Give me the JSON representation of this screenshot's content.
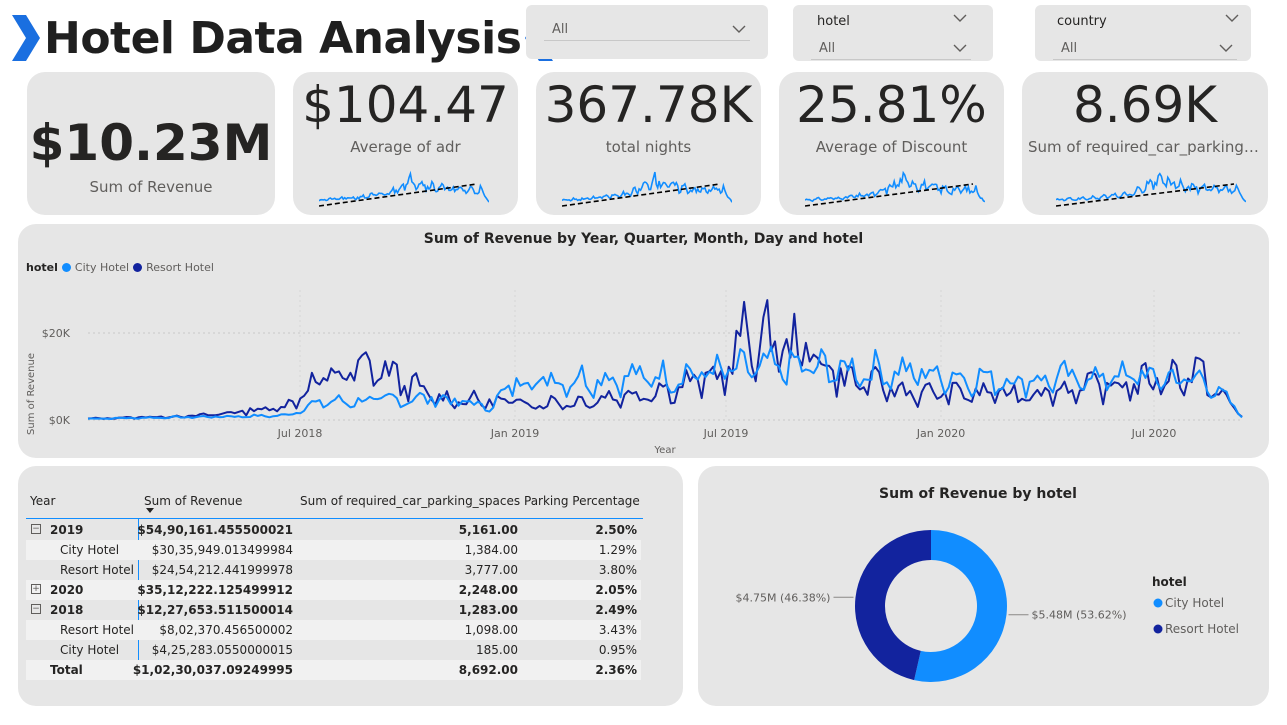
{
  "header": {
    "title": "Hotel Data Analysis"
  },
  "slicers": {
    "first": {
      "value": "All"
    },
    "hotel": {
      "title": "hotel",
      "value": "All"
    },
    "country": {
      "title": "country",
      "value": "All"
    }
  },
  "kpis": [
    {
      "value": "$10.23M",
      "label": "Sum of Revenue"
    },
    {
      "value": "$104.47",
      "label": "Average of adr"
    },
    {
      "value": "367.78K",
      "label": "total nights"
    },
    {
      "value": "25.81%",
      "label": "Average of Discount"
    },
    {
      "value": "8.69K",
      "label": "Sum of required_car_parking_spaces"
    }
  ],
  "colors": {
    "city_hotel": "#118DFF",
    "resort_hotel": "#12239E",
    "card_bg": "#e6e6e6",
    "chevron": "#1a6fe0"
  },
  "line_chart": {
    "title": "Sum of Revenue by Year, Quarter, Month, Day and hotel",
    "legend_title": "hotel",
    "legend_items": [
      "City Hotel",
      "Resort Hotel"
    ],
    "y_axis_label": "Sum of Revenue",
    "x_axis_label": "Year",
    "y_ticks": [
      "$20K",
      "$0K"
    ],
    "x_ticks": [
      "Jul 2018",
      "Jan 2019",
      "Jul 2019",
      "Jan 2020",
      "Jul 2020"
    ]
  },
  "table": {
    "headers": [
      "Year",
      "Sum of Revenue",
      "Sum of required_car_parking_spaces",
      "Parking Percentage"
    ],
    "rows": [
      {
        "kind": "year",
        "expander": "⊟",
        "label": "2019",
        "revenue": "$54,90,161.455500021",
        "parking": "5,161.00",
        "pct": "2.50%"
      },
      {
        "kind": "child",
        "label": "City Hotel",
        "revenue": "$30,35,949.013499984",
        "parking": "1,384.00",
        "pct": "1.29%"
      },
      {
        "kind": "child",
        "label": "Resort Hotel",
        "revenue": "$24,54,212.441999978",
        "parking": "3,777.00",
        "pct": "3.80%"
      },
      {
        "kind": "year",
        "expander": "⊞",
        "label": "2020",
        "revenue": "$35,12,222.125499912",
        "parking": "2,248.00",
        "pct": "2.05%"
      },
      {
        "kind": "year",
        "expander": "⊟",
        "label": "2018",
        "revenue": "$12,27,653.511500014",
        "parking": "1,283.00",
        "pct": "2.49%"
      },
      {
        "kind": "child",
        "label": "Resort Hotel",
        "revenue": "$8,02,370.456500002",
        "parking": "1,098.00",
        "pct": "3.43%"
      },
      {
        "kind": "child",
        "label": "City Hotel",
        "revenue": "$4,25,283.0550000015",
        "parking": "185.00",
        "pct": "0.95%"
      },
      {
        "kind": "total",
        "label": "Total",
        "revenue": "$1,02,30,037.09249995",
        "parking": "8,692.00",
        "pct": "2.36%"
      }
    ]
  },
  "chart_data": {
    "type": "pie",
    "title": "Sum of Revenue by hotel",
    "legend_title": "hotel",
    "legend_position": "right",
    "categories": [
      "City Hotel",
      "Resort Hotel"
    ],
    "values": [
      5.48,
      4.75
    ],
    "percent": [
      53.62,
      46.38
    ],
    "labels": [
      "$5.48M (53.62%)",
      "$4.75M (46.38%)"
    ],
    "unit": "$M"
  }
}
